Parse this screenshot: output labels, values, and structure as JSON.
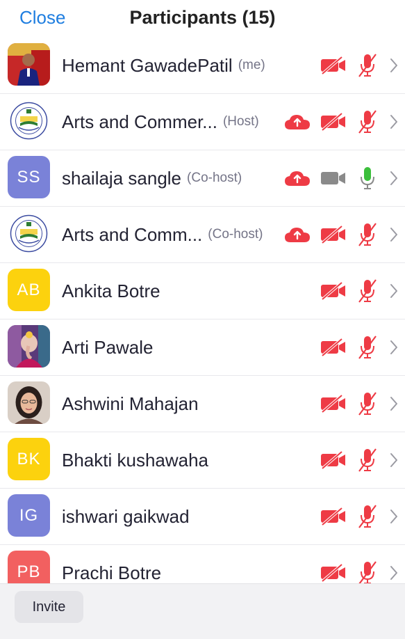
{
  "header": {
    "close_label": "Close",
    "title": "Participants (15)"
  },
  "colors": {
    "accent": "#1f7ee0",
    "muted_red": "#ee3b45",
    "unmuted_green": "#3bbf3b",
    "video_on_gray": "#8a8a8a",
    "avatar_purple": "#7a82d8",
    "avatar_yellow": "#fcd20e",
    "avatar_coral": "#f26060"
  },
  "participants": [
    {
      "name": "Hemant GawadePatil",
      "role": "(me)",
      "avatar_type": "photo-man",
      "avatar_initials": "",
      "cloud": false,
      "video": "off",
      "audio": "muted"
    },
    {
      "name": "Arts and Commer...",
      "role": "(Host)",
      "avatar_type": "logo",
      "avatar_initials": "",
      "cloud": true,
      "video": "off",
      "audio": "muted"
    },
    {
      "name": "shailaja sangle",
      "role": "(Co-host)",
      "avatar_type": "initials",
      "avatar_initials": "SS",
      "avatar_color": "#7a82d8",
      "cloud": true,
      "video": "on",
      "audio": "unmuted"
    },
    {
      "name": "Arts and Comm...",
      "role": "(Co-host)",
      "avatar_type": "logo",
      "avatar_initials": "",
      "cloud": true,
      "video": "off",
      "audio": "muted"
    },
    {
      "name": "Ankita Botre",
      "role": "",
      "avatar_type": "initials",
      "avatar_initials": "AB",
      "avatar_color": "#fcd20e",
      "cloud": false,
      "video": "off",
      "audio": "muted"
    },
    {
      "name": "Arti Pawale",
      "role": "",
      "avatar_type": "photo-ganesha",
      "avatar_initials": "",
      "cloud": false,
      "video": "off",
      "audio": "muted"
    },
    {
      "name": "Ashwini Mahajan",
      "role": "",
      "avatar_type": "photo-woman",
      "avatar_initials": "",
      "cloud": false,
      "video": "off",
      "audio": "muted"
    },
    {
      "name": "Bhakti kushawaha",
      "role": "",
      "avatar_type": "initials",
      "avatar_initials": "BK",
      "avatar_color": "#fcd20e",
      "cloud": false,
      "video": "off",
      "audio": "muted"
    },
    {
      "name": "ishwari gaikwad",
      "role": "",
      "avatar_type": "initials",
      "avatar_initials": "IG",
      "avatar_color": "#7a82d8",
      "cloud": false,
      "video": "off",
      "audio": "muted"
    },
    {
      "name": "Prachi Botre",
      "role": "",
      "avatar_type": "initials",
      "avatar_initials": "PB",
      "avatar_color": "#f26060",
      "cloud": false,
      "video": "off",
      "audio": "muted"
    }
  ],
  "footer": {
    "invite_label": "Invite"
  }
}
